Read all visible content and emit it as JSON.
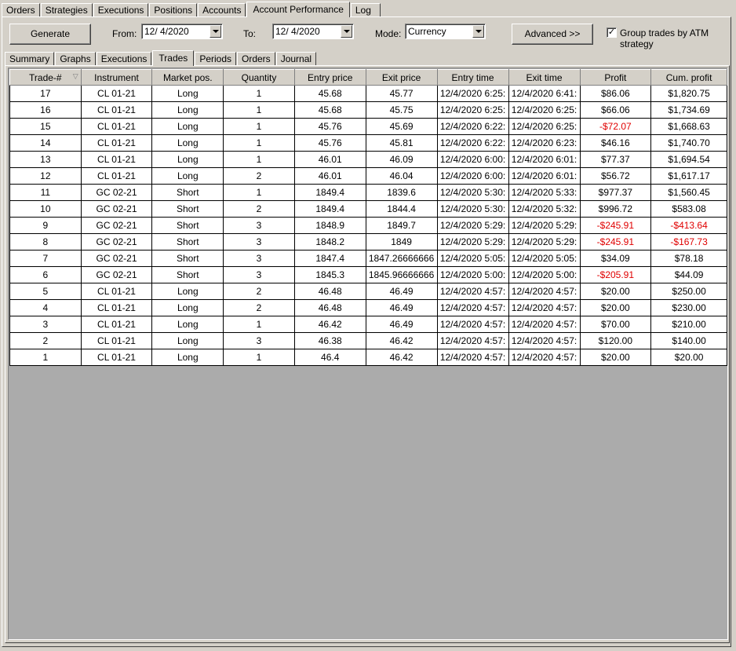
{
  "top_tabs": [
    "Orders",
    "Strategies",
    "Executions",
    "Positions",
    "Accounts",
    "Account Performance",
    "Log"
  ],
  "active_top_tab": "Account Performance",
  "toolbar": {
    "generate_label": "Generate",
    "from_label": "From:",
    "from_value": "12/  4/2020",
    "to_label": "To:",
    "to_value": "12/  4/2020",
    "mode_label": "Mode:",
    "mode_value": "Currency",
    "advanced_label": "Advanced >>",
    "group_checkbox_label": "Group trades by ATM strategy",
    "group_checked": true,
    "check_mark": "✓"
  },
  "sub_tabs": [
    "Summary",
    "Graphs",
    "Executions",
    "Trades",
    "Periods",
    "Orders",
    "Journal"
  ],
  "active_sub_tab": "Trades",
  "table": {
    "sort_icon": "▽",
    "headers": [
      "Trade-#",
      "Instrument",
      "Market pos.",
      "Quantity",
      "Entry price",
      "Exit price",
      "Entry time",
      "Exit time",
      "Profit",
      "Cum. profit"
    ],
    "rows": [
      [
        "17",
        "CL 01-21",
        "Long",
        "1",
        "45.68",
        "45.77",
        "12/4/2020 6:25:",
        "12/4/2020 6:41:",
        "$86.06",
        "$1,820.75"
      ],
      [
        "16",
        "CL 01-21",
        "Long",
        "1",
        "45.68",
        "45.75",
        "12/4/2020 6:25:",
        "12/4/2020 6:25:",
        "$66.06",
        "$1,734.69"
      ],
      [
        "15",
        "CL 01-21",
        "Long",
        "1",
        "45.76",
        "45.69",
        "12/4/2020 6:22:",
        "12/4/2020 6:25:",
        "-$72.07",
        "$1,668.63"
      ],
      [
        "14",
        "CL 01-21",
        "Long",
        "1",
        "45.76",
        "45.81",
        "12/4/2020 6:22:",
        "12/4/2020 6:23:",
        "$46.16",
        "$1,740.70"
      ],
      [
        "13",
        "CL 01-21",
        "Long",
        "1",
        "46.01",
        "46.09",
        "12/4/2020 6:00:",
        "12/4/2020 6:01:",
        "$77.37",
        "$1,694.54"
      ],
      [
        "12",
        "CL 01-21",
        "Long",
        "2",
        "46.01",
        "46.04",
        "12/4/2020 6:00:",
        "12/4/2020 6:01:",
        "$56.72",
        "$1,617.17"
      ],
      [
        "11",
        "GC 02-21",
        "Short",
        "1",
        "1849.4",
        "1839.6",
        "12/4/2020 5:30:",
        "12/4/2020 5:33:",
        "$977.37",
        "$1,560.45"
      ],
      [
        "10",
        "GC 02-21",
        "Short",
        "2",
        "1849.4",
        "1844.4",
        "12/4/2020 5:30:",
        "12/4/2020 5:32:",
        "$996.72",
        "$583.08"
      ],
      [
        "9",
        "GC 02-21",
        "Short",
        "3",
        "1848.9",
        "1849.7",
        "12/4/2020 5:29:",
        "12/4/2020 5:29:",
        "-$245.91",
        "-$413.64"
      ],
      [
        "8",
        "GC 02-21",
        "Short",
        "3",
        "1848.2",
        "1849",
        "12/4/2020 5:29:",
        "12/4/2020 5:29:",
        "-$245.91",
        "-$167.73"
      ],
      [
        "7",
        "GC 02-21",
        "Short",
        "3",
        "1847.4",
        "1847.26666666",
        "12/4/2020 5:05:",
        "12/4/2020 5:05:",
        "$34.09",
        "$78.18"
      ],
      [
        "6",
        "GC 02-21",
        "Short",
        "3",
        "1845.3",
        "1845.96666666",
        "12/4/2020 5:00:",
        "12/4/2020 5:00:",
        "-$205.91",
        "$44.09"
      ],
      [
        "5",
        "CL 01-21",
        "Long",
        "2",
        "46.48",
        "46.49",
        "12/4/2020 4:57:",
        "12/4/2020 4:57:",
        "$20.00",
        "$250.00"
      ],
      [
        "4",
        "CL 01-21",
        "Long",
        "2",
        "46.48",
        "46.49",
        "12/4/2020 4:57:",
        "12/4/2020 4:57:",
        "$20.00",
        "$230.00"
      ],
      [
        "3",
        "CL 01-21",
        "Long",
        "1",
        "46.42",
        "46.49",
        "12/4/2020 4:57:",
        "12/4/2020 4:57:",
        "$70.00",
        "$210.00"
      ],
      [
        "2",
        "CL 01-21",
        "Long",
        "3",
        "46.38",
        "46.42",
        "12/4/2020 4:57:",
        "12/4/2020 4:57:",
        "$120.00",
        "$140.00"
      ],
      [
        "1",
        "CL 01-21",
        "Long",
        "1",
        "46.4",
        "46.42",
        "12/4/2020 4:57:",
        "12/4/2020 4:57:",
        "$20.00",
        "$20.00"
      ]
    ]
  },
  "colors": {
    "negative": "#e00000",
    "window_bg": "#d4d0c8",
    "grid_empty_bg": "#ababab"
  }
}
